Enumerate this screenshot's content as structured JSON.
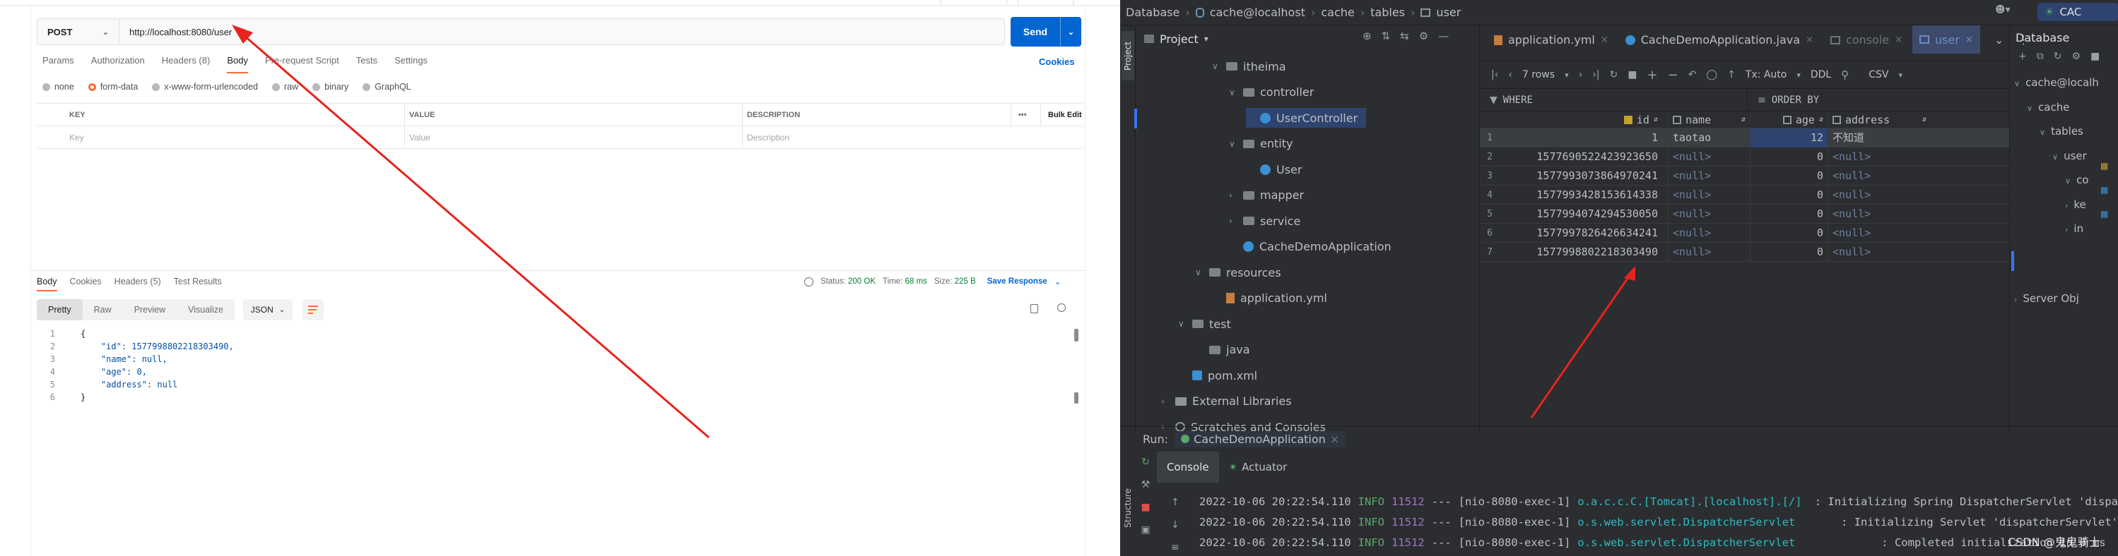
{
  "postman": {
    "method": "POST",
    "url": "http://localhost:8080/user",
    "send": "Send",
    "req_tabs": [
      "Params",
      "Authorization",
      "Headers (8)",
      "Body",
      "Pre-request Script",
      "Tests",
      "Settings"
    ],
    "cookies": "Cookies",
    "body_types": [
      "none",
      "form-data",
      "x-www-form-urlencoded",
      "raw",
      "binary",
      "GraphQL"
    ],
    "kv_headers": {
      "key": "KEY",
      "value": "VALUE",
      "desc": "DESCRIPTION",
      "bulk": "Bulk Edit",
      "more": "•••"
    },
    "kv_placeholders": {
      "key": "Key",
      "value": "Value",
      "desc": "Description"
    },
    "resp_tabs": [
      "Body",
      "Cookies",
      "Headers (5)",
      "Test Results"
    ],
    "status": {
      "status_label": "Status:",
      "status": "200 OK",
      "time_label": "Time:",
      "time": "68 ms",
      "size_label": "Size:",
      "size": "225 B",
      "save": "Save Response"
    },
    "view_tabs": [
      "Pretty",
      "Raw",
      "Preview",
      "Visualize"
    ],
    "format": "JSON",
    "code_lines": [
      {
        "n": "1",
        "t": "{"
      },
      {
        "n": "2",
        "t": "    \"id\": 1577998802218303490,"
      },
      {
        "n": "3",
        "t": "    \"name\": null,"
      },
      {
        "n": "4",
        "t": "    \"age\": 0,"
      },
      {
        "n": "5",
        "t": "    \"address\": null"
      },
      {
        "n": "6",
        "t": "}"
      }
    ]
  },
  "ide": {
    "breadcrumb": [
      "Database",
      "cache@localhost",
      "cache",
      "tables",
      "user"
    ],
    "account_text": "CAC",
    "project_label": "Project",
    "side_label": "Project",
    "tree": [
      {
        "label": "itheima",
        "depth": 0,
        "arrow": "v",
        "icon": "folder"
      },
      {
        "label": "controller",
        "depth": 1,
        "arrow": "v",
        "icon": "folder"
      },
      {
        "label": "UserController",
        "depth": 2,
        "arrow": "",
        "icon": "class"
      },
      {
        "label": "entity",
        "depth": 1,
        "arrow": "v",
        "icon": "folder"
      },
      {
        "label": "User",
        "depth": 2,
        "arrow": "",
        "icon": "class"
      },
      {
        "label": "mapper",
        "depth": 1,
        "arrow": ">",
        "icon": "folder"
      },
      {
        "label": "service",
        "depth": 1,
        "arrow": ">",
        "icon": "folder"
      },
      {
        "label": "CacheDemoApplication",
        "depth": 1,
        "arrow": "",
        "icon": "app"
      },
      {
        "label": "resources",
        "depth": -1,
        "arrow": "v",
        "icon": "folder"
      },
      {
        "label": "application.yml",
        "depth": 0,
        "arrow": "",
        "icon": "yml"
      },
      {
        "label": "test",
        "depth": -2,
        "arrow": "v",
        "icon": "folder"
      },
      {
        "label": "java",
        "depth": -1,
        "arrow": "",
        "icon": "folder"
      },
      {
        "label": "pom.xml",
        "depth": -2,
        "arrow": "",
        "icon": "pom"
      },
      {
        "label": "External Libraries",
        "depth": -3,
        "arrow": ">",
        "icon": "lib"
      },
      {
        "label": "Scratches and Consoles",
        "depth": -3,
        "arrow": ">",
        "icon": "scratch"
      }
    ],
    "editor_tabs": [
      "application.yml",
      "CacheDemoApplication.java",
      "console",
      "user"
    ],
    "toolbar": {
      "rows": "7 rows",
      "tx": "Tx: Auto",
      "ddl": "DDL",
      "csv": "CSV"
    },
    "filter": {
      "where": "WHERE",
      "order": "ORDER BY"
    },
    "columns": [
      "id",
      "name",
      "age",
      "address"
    ],
    "rows": [
      {
        "n": "1",
        "id": "1",
        "name": "taotao",
        "age": "12",
        "address": "不知道"
      },
      {
        "n": "2",
        "id": "1577690522423923650",
        "name": "<null>",
        "age": "0",
        "address": "<null>"
      },
      {
        "n": "3",
        "id": "1577993073864970241",
        "name": "<null>",
        "age": "0",
        "address": "<null>"
      },
      {
        "n": "4",
        "id": "1577993428153614338",
        "name": "<null>",
        "age": "0",
        "address": "<null>"
      },
      {
        "n": "5",
        "id": "1577994074294530050",
        "name": "<null>",
        "age": "0",
        "address": "<null>"
      },
      {
        "n": "6",
        "id": "1577997826426634241",
        "name": "<null>",
        "age": "0",
        "address": "<null>"
      },
      {
        "n": "7",
        "id": "1577998802218303490",
        "name": "<null>",
        "age": "0",
        "address": "<null>"
      }
    ],
    "db_panel": {
      "title": "Database",
      "items": [
        {
          "label": "cache@localh",
          "depth": 0
        },
        {
          "label": "cache",
          "depth": 1
        },
        {
          "label": "tables",
          "depth": 2
        },
        {
          "label": "user",
          "depth": 3
        },
        {
          "label": "co",
          "depth": 4
        },
        {
          "label": "ke",
          "depth": 4
        },
        {
          "label": "in",
          "depth": 4
        },
        {
          "label": "Server Obj",
          "depth": 0
        }
      ]
    },
    "run": {
      "label": "Run:",
      "config": "CacheDemoApplication",
      "tabs": [
        "Console",
        "Actuator"
      ],
      "logs": [
        {
          "ts": "2022-10-06 20:22:54.110",
          "lvl": "INFO",
          "pid": "11512",
          "sep": "---",
          "thread": "[nio-8080-exec-1]",
          "cls": "o.a.c.c.C.[Tomcat].[localhost].[/]",
          "msg": ": Initializing Spring DispatcherServlet 'dispa"
        },
        {
          "ts": "2022-10-06 20:22:54.110",
          "lvl": "INFO",
          "pid": "11512",
          "sep": "---",
          "thread": "[nio-8080-exec-1]",
          "cls": "o.s.web.servlet.DispatcherServlet",
          "msg": ": Initializing Servlet 'dispatcherServlet'"
        },
        {
          "ts": "2022-10-06 20:22:54.110",
          "lvl": "INFO",
          "pid": "11512",
          "sep": "---",
          "thread": "[nio-8080-exec-1]",
          "cls": "o.s.web.servlet.DispatcherServlet",
          "msg": ": Completed initialization in 0 ms"
        }
      ],
      "structure_label": "Structure"
    },
    "watermark": "CSDN @鬼鬼骑士"
  },
  "colors": {
    "accent_orange": "#ff6c37",
    "send_blue": "#0265d2",
    "annotation_red": "#e8231d",
    "ide_select": "#2e436e"
  }
}
